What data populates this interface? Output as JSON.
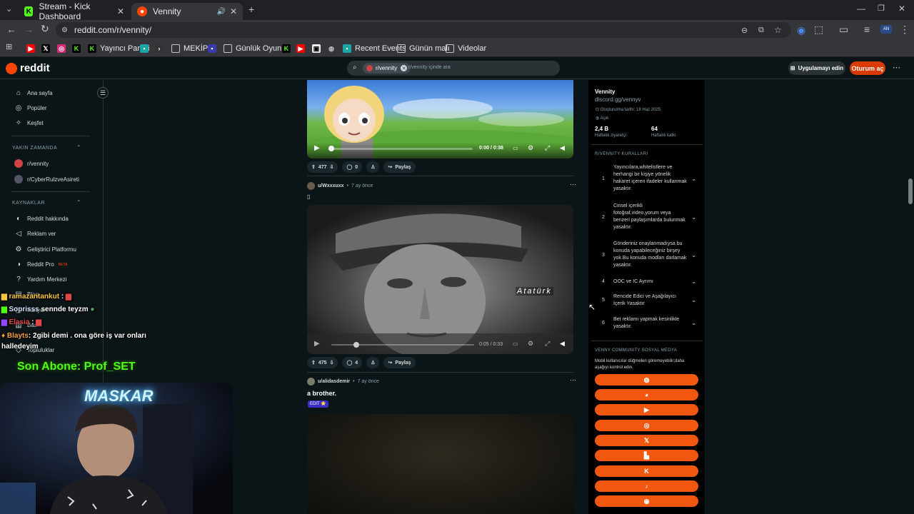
{
  "browser": {
    "tabs": [
      {
        "title": "Stream - Kick Dashboard",
        "favicon": "kick-icon",
        "color": "#53fc18"
      },
      {
        "title": "Vennity",
        "favicon": "reddit-icon",
        "color": "#ff4500"
      }
    ],
    "url": "reddit.com/r/vennity/",
    "bookmarks": [
      {
        "label": "Yayıncı Paneli",
        "icon": "kick-icon"
      },
      {
        "label": "MEKİP",
        "icon": "folder-icon"
      },
      {
        "label": "Günlük Oyunlar",
        "icon": "folder-icon"
      },
      {
        "label": "Recent Events",
        "icon": "streamelements-icon"
      },
      {
        "label": "Günün malı",
        "icon": "folder-icon"
      },
      {
        "label": "Videolar",
        "icon": "folder-icon"
      }
    ]
  },
  "reddit": {
    "logo": "reddit",
    "search_chip": "r/vennity",
    "search_placeholder": "r/vennity içinde ara",
    "get_app": "Uygulamayı edin",
    "login": "Oturum aç"
  },
  "leftnav": {
    "main": [
      "Ana sayfa",
      "Popüler",
      "Keşfet"
    ],
    "recent_header": "YAKIN ZAMANDA",
    "recent": [
      "r/vennity",
      "r/CyberRulzveAsireti"
    ],
    "resources_header": "KAYNAKLAR",
    "resources": [
      "Reddit hakkında",
      "Reklam ver",
      "Geliştirici Platformu",
      "Reddit Pro",
      "Yardım Merkezi"
    ],
    "pro_badge": "BETA",
    "partial": [
      "Blog",
      "Kariyer",
      "Basın",
      "Topluluklar"
    ]
  },
  "posts": [
    {
      "video_time": "0:00 / 0:38",
      "upvotes": "477",
      "comments": "0",
      "share": "Paylaş"
    },
    {
      "user": "u/Wxxxuxx",
      "age": "7 ay önce",
      "title": "▯",
      "overlay_text": "Atatürk",
      "video_time": "0:05 / 0:33",
      "upvotes": "475",
      "comments": "4",
      "share": "Paylaş"
    },
    {
      "user": "u/alidasdemir",
      "age": "7 ay önce",
      "title": "a brother.",
      "flair": "EDIT ⭐"
    }
  ],
  "community": {
    "name": "Vennity",
    "link": "discord.gg/vennyv",
    "created": "Oluşturulma tarihi: 18 Haz 2025",
    "visibility": "Açık",
    "weekly_visitors": "2,4 B",
    "weekly_visitors_label": "Haftalık ziyaretçi",
    "weekly_contrib": "64",
    "weekly_contrib_label": "Haftalık katkı",
    "rules_header": "R/VENNITY KURALLARI",
    "rules": [
      "Yayıncılara,whitelistlere ve herhangi bir kişiye yönelik hakaret içeren ifadeler kullanmak yasaktır.",
      "Cinsel içerikli fotoğraf,video,yorum veya benzeri paylaşımlarda bulunmak yasaktır.",
      "Gönderiniz onaylanmadıysa bu konuda yapabileceğiniz birşey yok.Bu konuda modları darlamak yasaktır.",
      "OOC ve IC Ayrımı",
      "Rencide Edici ve Aşağılayıcı İçerik Yasaktır",
      "Bet reklamı yapmak kesinlikle yasaktır."
    ],
    "social_header": "VENNY COMMUNITY SOSYAL MEDYA",
    "social_desc": "Mobil kullanıcılar düğmeleri göremeyebilir;daha aşağıyı kontrol edin.",
    "social_icons": [
      "globe-icon",
      "discord-icon",
      "youtube-icon",
      "instagram-icon",
      "x-icon",
      "twitch-icon",
      "kick-icon",
      "tiktok-icon",
      "steam-icon"
    ]
  },
  "stream_overlay": {
    "chat": [
      {
        "user": "ramazantankut",
        "msg": ":"
      },
      {
        "user": "Soprisss",
        "msg": "sennde teyzm"
      },
      {
        "user": "Elasia",
        "msg": ":"
      },
      {
        "user": "Blayts",
        "msg": ": 2gibi demi . ona göre iş var onları halledeyim"
      }
    ],
    "last_sub": "Son Abone: Prof_SET",
    "neon_sign": "MASKAR"
  }
}
